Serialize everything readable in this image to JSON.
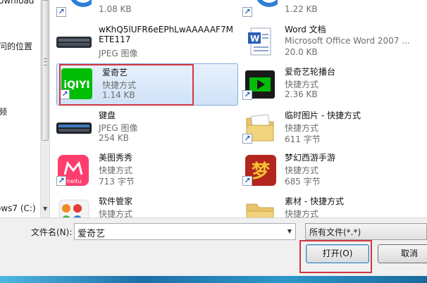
{
  "nav": {
    "items": [
      {
        "label": "ownload"
      },
      {
        "label": "问的位置"
      },
      {
        "label": "频"
      },
      {
        "label": "ows7 (C:)"
      }
    ]
  },
  "files": [
    {
      "name": "",
      "type": "",
      "size": "1.08 KB",
      "icon": "partial-blue-circle-shortcut-icon",
      "shortcut": true
    },
    {
      "name": "",
      "type": "",
      "size": "1.22 KB",
      "icon": "partial-blue-circle-shortcut-icon",
      "shortcut": true
    },
    {
      "name": "wKhQ5lUFR6eEPhLwAAAAAF7METE117",
      "name_line1": "wKhQ5lUFR6eEPhLwAAAAAF7M",
      "name_line2": "ETE117",
      "type": "JPEG 图像",
      "size": "",
      "icon": "keyboard-photo-thumbnail"
    },
    {
      "name": "Word 文档",
      "type": "Microsoft Office Word 2007 ...",
      "size": "20.0 KB",
      "icon": "word-document-icon"
    },
    {
      "name": "爱奇艺",
      "type": "快捷方式",
      "size": "1.14 KB",
      "icon": "iqiyi-app-icon",
      "shortcut": true,
      "selected": true,
      "logo_text": "iQIYI"
    },
    {
      "name": "爱奇艺轮播台",
      "type": "快捷方式",
      "size": "2.36 KB",
      "icon": "iqiyi-carousel-play-icon",
      "shortcut": true
    },
    {
      "name": "键盘",
      "type": "JPEG 图像",
      "size": "254 KB",
      "icon": "keyboard-photo-thumbnail"
    },
    {
      "name": "临时图片 - 快捷方式",
      "type": "快捷方式",
      "size": "611 字节",
      "icon": "folder-shortcut-icon",
      "shortcut": true
    },
    {
      "name": "美图秀秀",
      "type": "快捷方式",
      "size": "713 字节",
      "icon": "meitu-app-icon",
      "shortcut": true,
      "logo_text": "meitu"
    },
    {
      "name": "梦幻西游手游",
      "type": "快捷方式",
      "size": "685 字节",
      "icon": "menghuan-game-icon",
      "shortcut": true,
      "logo_text": "梦"
    },
    {
      "name": "软件管家",
      "type": "快捷方式",
      "size": "",
      "icon": "software-manager-icon",
      "shortcut": true
    },
    {
      "name": "素材 - 快捷方式",
      "type": "快捷方式",
      "size": "",
      "icon": "folder-shortcut-icon",
      "shortcut": true
    }
  ],
  "footer": {
    "filename_label": "文件名(N):",
    "filename_value": "爱奇艺",
    "filter_value": "所有文件(*.*)",
    "open_button": "打开(O)",
    "cancel_button": "取消"
  },
  "colors": {
    "highlight": "#d0373f",
    "selection": "#cfe2f8",
    "iqiyi_green": "#00be06",
    "meitu_pink": "#ff3d6e"
  }
}
